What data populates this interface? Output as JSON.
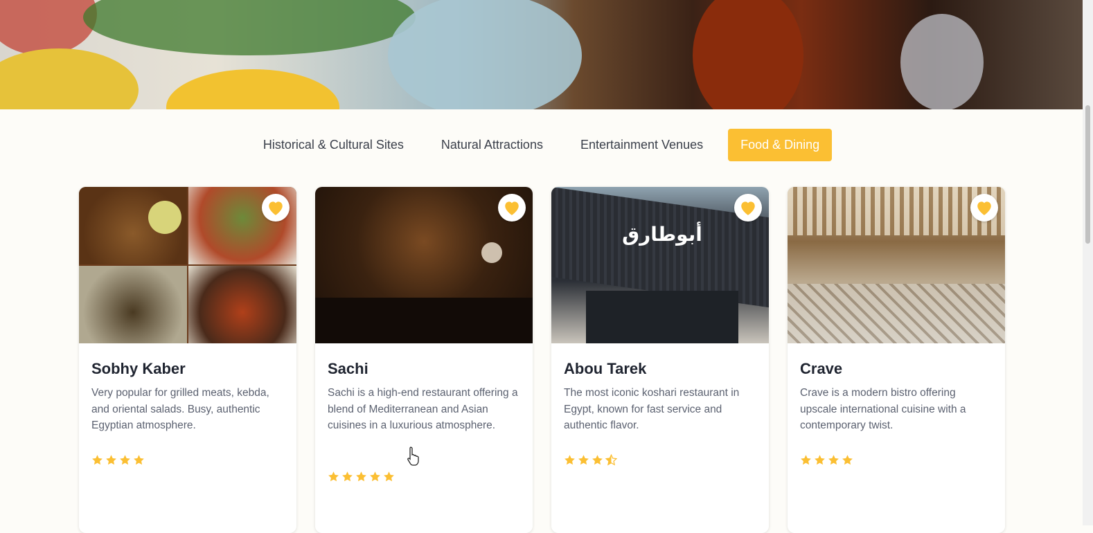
{
  "tabs": [
    {
      "label": "Historical & Cultural Sites",
      "active": false
    },
    {
      "label": "Natural Attractions",
      "active": false
    },
    {
      "label": "Entertainment Venues",
      "active": false
    },
    {
      "label": "Food & Dining",
      "active": true
    }
  ],
  "colors": {
    "accent": "#fbbf33",
    "star": "#fbbf33",
    "background": "#fdfcf8"
  },
  "cards": [
    {
      "name": "Sobhy Kaber",
      "description": "Very popular for grilled meats, kebda, and oriental salads. Busy, authentic Egyptian atmosphere.",
      "rating": 4,
      "image": "food-collage"
    },
    {
      "name": "Sachi",
      "description": "Sachi is a high-end restaurant offering a blend of Mediterranean and Asian cuisines in a luxurious atmosphere.",
      "rating": 5,
      "image": "restaurant-interior"
    },
    {
      "name": "Abou Tarek",
      "description": "The most iconic koshari restaurant in Egypt, known for fast service and authentic flavor.",
      "rating": 3.5,
      "image": "storefront"
    },
    {
      "name": "Crave",
      "description": "Crave is a modern bistro offering upscale international cuisine with a contemporary twist.",
      "rating": 4,
      "image": "patio-dining"
    }
  ]
}
